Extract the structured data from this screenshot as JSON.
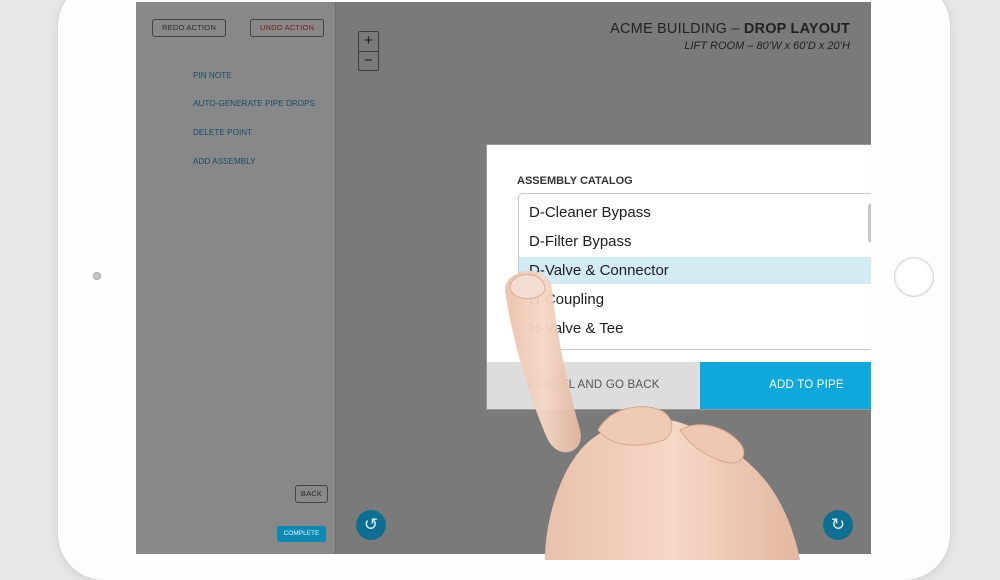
{
  "toolbar": {
    "redo_label": "REDO ACTION",
    "undo_label": "UNDO ACTION"
  },
  "tools": {
    "items": [
      {
        "label": "PIN NOTE"
      },
      {
        "label": "AUTO-GENERATE PIPE DROPS"
      },
      {
        "label": "DELETE POINT"
      },
      {
        "label": "ADD ASSEMBLY"
      }
    ],
    "back_label": "BACK",
    "complete_label": "COMPLETE"
  },
  "zoom": {
    "in_label": "+",
    "out_label": "−"
  },
  "header": {
    "building": "ACME BUILDING – ",
    "layout": "DROP LAYOUT",
    "room": "LIFT ROOM – 80’W x 60’D x 20’H"
  },
  "dialog": {
    "title": "ASSEMBLY CATALOG",
    "items": [
      {
        "label": "D-Cleaner Bypass"
      },
      {
        "label": "D-Filter Bypass"
      },
      {
        "label": "D-Valve & Connector"
      },
      {
        "label": "H-Coupling"
      },
      {
        "label": "H-Valve & Tee"
      }
    ],
    "selected_index": 2,
    "cancel_label": "CANCEL AND GO BACK",
    "add_label": "ADD TO PIPE"
  },
  "icons": {
    "rotate_left": "rotate-left-icon",
    "rotate_right": "rotate-right-icon"
  },
  "colors": {
    "accent": "#10a7dc",
    "selected_row": "#d3ebf3",
    "menu_text": "#164e6b"
  }
}
